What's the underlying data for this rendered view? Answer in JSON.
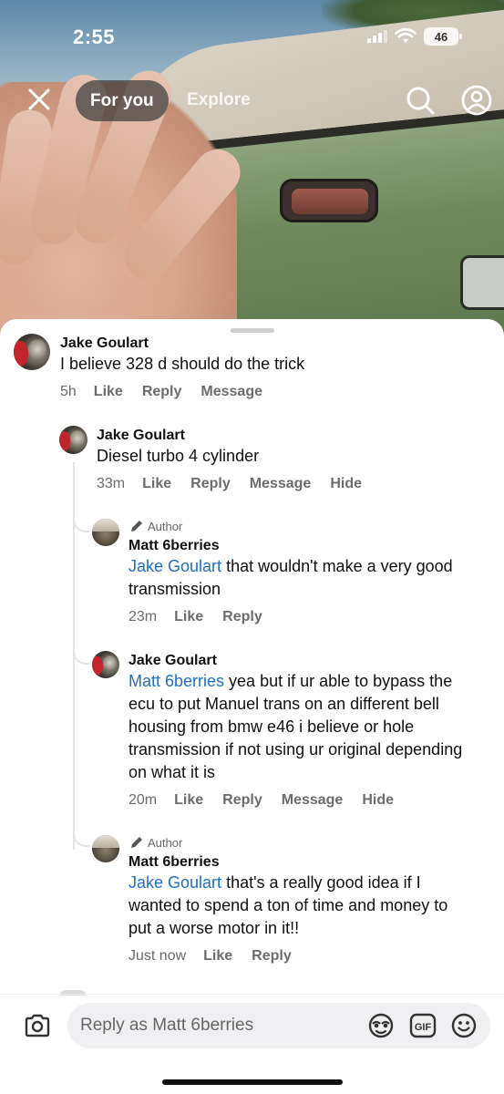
{
  "status_bar": {
    "time": "2:55",
    "battery": "46"
  },
  "top_nav": {
    "tab_for_you": "For you",
    "tab_explore": "Explore"
  },
  "comments": [
    {
      "name": "Jake Goulart",
      "text": "I believe 328 d should do the trick",
      "time": "5h",
      "actions": [
        "Like",
        "Reply",
        "Message"
      ]
    },
    {
      "name": "Jake Goulart",
      "text": "Diesel turbo 4 cylinder",
      "time": "33m",
      "actions": [
        "Like",
        "Reply",
        "Message",
        "Hide"
      ]
    },
    {
      "author_tag": "Author",
      "name": "Matt 6berries",
      "mention": "Jake Goulart",
      "text_line1": " that wouldn't make a very good",
      "text_line2": "transmission",
      "time": "23m",
      "actions": [
        "Like",
        "Reply"
      ]
    },
    {
      "name": "Jake Goulart",
      "mention": "Matt 6berries",
      "text_line1": " yea but if ur able to bypass the",
      "text_line2": "ecu to put Manuel trans on an different bell",
      "text_line3": "housing from bmw e46 i believe or hole",
      "text_line4": "transmission if not using ur original depending",
      "text_line5": "on what it is",
      "time": "20m",
      "actions": [
        "Like",
        "Reply",
        "Message",
        "Hide"
      ]
    },
    {
      "author_tag": "Author",
      "name": "Matt 6berries",
      "mention": "Jake Goulart",
      "text_line1": " that's a really good idea if I",
      "text_line2": "wanted to spend a ton of time and money to",
      "text_line3": "put a worse motor in it!!",
      "time": "Just now",
      "actions": [
        "Like",
        "Reply"
      ]
    }
  ],
  "reply_bar": {
    "placeholder": "Reply as Matt 6berries"
  }
}
